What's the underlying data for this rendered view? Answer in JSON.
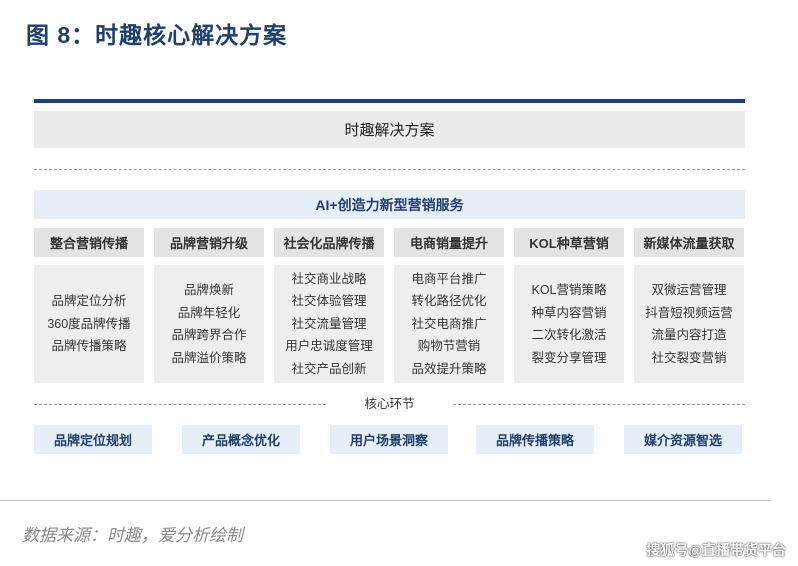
{
  "figure_title": "图 8：时趣核心解决方案",
  "header": "时趣解决方案",
  "service_bar": "AI+创造力新型营销服务",
  "columns": [
    {
      "title": "整合营销传播",
      "items": [
        "品牌定位分析",
        "360度品牌传播",
        "品牌传播策略"
      ]
    },
    {
      "title": "品牌营销升级",
      "items": [
        "品牌焕新",
        "品牌年轻化",
        "品牌跨界合作",
        "品牌溢价策略"
      ]
    },
    {
      "title": "社会化品牌传播",
      "items": [
        "社交商业战略",
        "社交体验管理",
        "社交流量管理",
        "用户忠诚度管理",
        "社交产品创新"
      ]
    },
    {
      "title": "电商销量提升",
      "items": [
        "电商平台推广",
        "转化路径优化",
        "社交电商推广",
        "购物节营销",
        "品效提升策略"
      ]
    },
    {
      "title": "KOL种草营销",
      "items": [
        "KOL营销策略",
        "种草内容营销",
        "二次转化激活",
        "裂变分享管理"
      ]
    },
    {
      "title": "新媒体流量获取",
      "items": [
        "双微运营管理",
        "抖音短视频运营",
        "流量内容打造",
        "社交裂变营销"
      ]
    }
  ],
  "core_label": "核心环节",
  "core_items": [
    "品牌定位规划",
    "产品概念优化",
    "用户场景洞察",
    "品牌传播策略",
    "媒介资源智选"
  ],
  "source": "数据来源：时趣，爱分析绘制",
  "watermark": "搜狐号@直播带货平台"
}
